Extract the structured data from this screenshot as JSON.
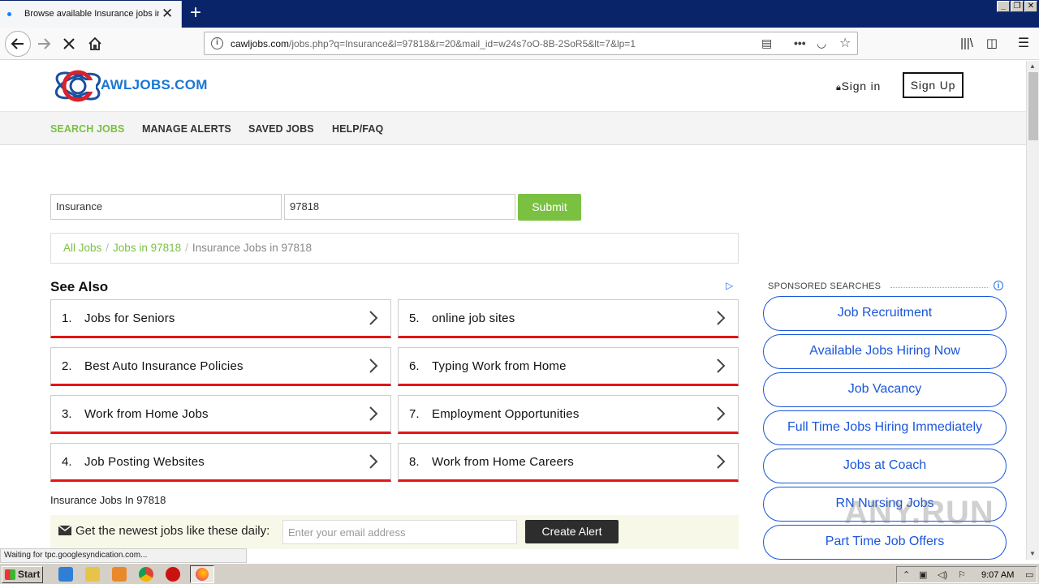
{
  "browser": {
    "tab_title": "Browse available Insurance jobs in",
    "url_domain": "cawljobs.com",
    "url_path": "/jobs.php?q=Insurance&l=97818&r=20&mail_id=w24s7oO-8B-2SoR5&lt=7&lp=1",
    "status_text": "Waiting for tpc.googlesyndication.com..."
  },
  "site": {
    "logo_text": "AWLJOBS.COM",
    "sign_in": "Sign in",
    "sign_up": "Sign Up",
    "nav": [
      "SEARCH JOBS",
      "MANAGE ALERTS",
      "SAVED JOBS",
      "HELP/FAQ"
    ],
    "accent_color": "#7ac142"
  },
  "search": {
    "keyword_value": "Insurance",
    "location_value": "97818",
    "submit_label": "Submit"
  },
  "breadcrumb": {
    "items": [
      "All Jobs",
      "Jobs in 97818"
    ],
    "current": "Insurance Jobs in 97818"
  },
  "see_also": {
    "heading": "See Also",
    "items": [
      {
        "num": "1.",
        "text": "Jobs for Seniors"
      },
      {
        "num": "2.",
        "text": "Best Auto Insurance Policies"
      },
      {
        "num": "3.",
        "text": "Work from Home Jobs"
      },
      {
        "num": "4.",
        "text": "Job Posting Websites"
      },
      {
        "num": "5.",
        "text": "online job sites"
      },
      {
        "num": "6.",
        "text": "Typing Work from Home"
      },
      {
        "num": "7.",
        "text": "Employment Opportunities"
      },
      {
        "num": "8.",
        "text": "Work from Home Careers"
      }
    ]
  },
  "results": {
    "title": "Insurance Jobs In 97818"
  },
  "alert": {
    "label": "Get the newest jobs like these daily:",
    "email_placeholder": "Enter your email address",
    "create_label": "Create Alert"
  },
  "sponsored": {
    "heading": "SPONSORED SEARCHES",
    "items": [
      "Job Recruitment",
      "Available Jobs Hiring Now",
      "Job Vacancy",
      "Full Time Jobs Hiring Immediately",
      "Jobs at Coach",
      "RN Nursing Jobs",
      "Part Time Job Offers"
    ]
  },
  "taskbar": {
    "start_label": "Start",
    "clock": "9:07 AM"
  },
  "watermark": "ANY.RUN"
}
